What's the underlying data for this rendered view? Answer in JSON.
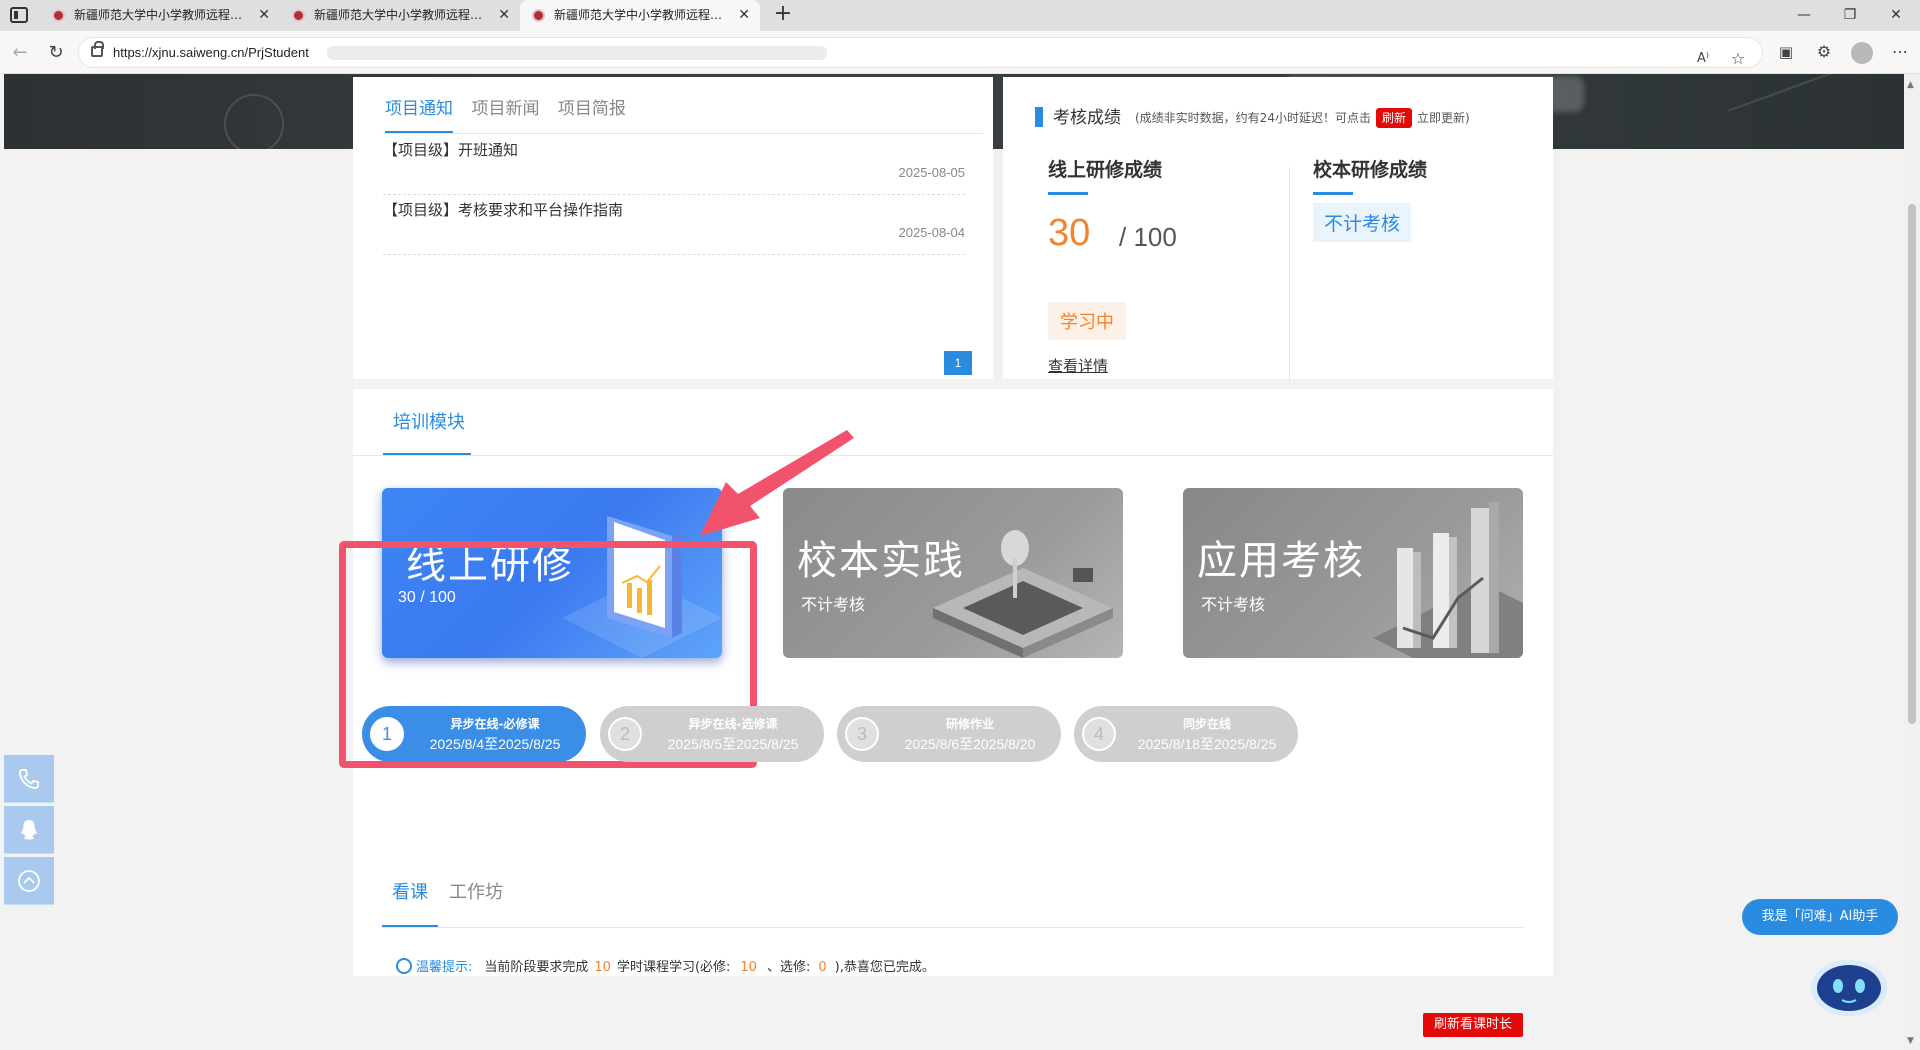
{
  "browser": {
    "tabs": [
      {
        "title": "新疆师范大学中小学教师远程培训"
      },
      {
        "title": "新疆师范大学中小学教师远程培训"
      },
      {
        "title": "新疆师范大学中小学教师远程培训"
      }
    ],
    "url": "https://xjnu.saiweng.cn/PrjStudent"
  },
  "notice": {
    "tabs": [
      "项目通知",
      "项目新闻",
      "项目简报"
    ],
    "items": [
      {
        "title": "【项目级】开班通知",
        "date": "2025-08-05"
      },
      {
        "title": "【项目级】考核要求和平台操作指南",
        "date": "2025-08-04"
      }
    ],
    "page": "1"
  },
  "score": {
    "title": "考核成绩",
    "note_prefix": "(成绩非实时数据，约有24小时延迟！可点击",
    "refresh_label": "刷新",
    "note_suffix": "立即更新)",
    "online_title": "线上研修成绩",
    "online_value": "30",
    "online_total": "/ 100",
    "status": "学习中",
    "detail_link": "查看详情",
    "school_title": "校本研修成绩",
    "school_status": "不计考核"
  },
  "modules": {
    "tab": "培训模块",
    "cards": [
      {
        "title": "线上研修",
        "sub": "30 / 100"
      },
      {
        "title": "校本实践",
        "sub": "不计考核"
      },
      {
        "title": "应用考核",
        "sub": "不计考核"
      }
    ]
  },
  "steps": [
    {
      "num": "1",
      "name": "异步在线-必修课",
      "date": "2025/8/4至2025/8/25"
    },
    {
      "num": "2",
      "name": "异步在线-选修课",
      "date": "2025/8/5至2025/8/25"
    },
    {
      "num": "3",
      "name": "研修作业",
      "date": "2025/8/6至2025/8/20"
    },
    {
      "num": "4",
      "name": "同步在线",
      "date": "2025/8/18至2025/8/25"
    }
  ],
  "course_tabs": [
    "看课",
    "工作坊"
  ],
  "tip": {
    "label": "温馨提示:",
    "t1": "当前阶段要求完成",
    "n1": "10",
    "t2": "学时课程学习(必修:",
    "n2": "10",
    "t3": "、选修:",
    "n3": "0",
    "t4": "),恭喜您已完成。"
  },
  "refresh_time_label": "刷新看课时长",
  "ai_assistant_label": "我是「问难」AI助手",
  "colors": {
    "primary": "#2a8ce0",
    "accent_orange": "#f5832d",
    "danger": "#e30a0a",
    "highlight": "#f0536b"
  }
}
